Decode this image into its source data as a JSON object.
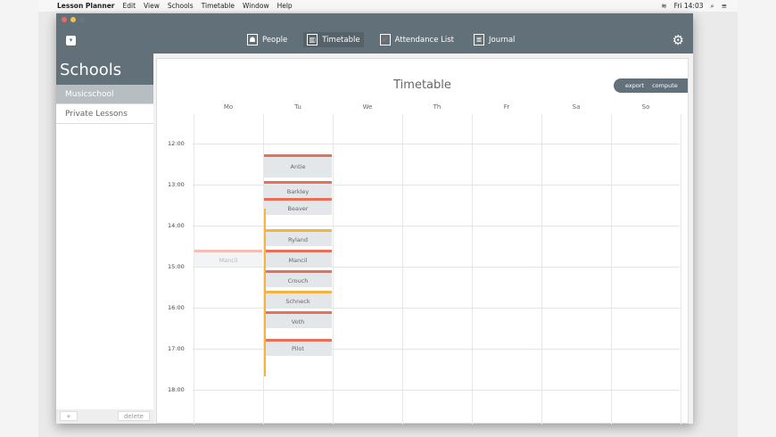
{
  "menubar": {
    "app": "Lesson Planner",
    "items": [
      "Edit",
      "View",
      "Schools",
      "Timetable",
      "Window",
      "Help"
    ],
    "clock": "Fri 14:03"
  },
  "toolbar": {
    "nav": [
      {
        "label": "People",
        "icon": "people-icon"
      },
      {
        "label": "Timetable",
        "icon": "timetable-icon",
        "active": true
      },
      {
        "label": "Attendance List",
        "icon": "checklist-icon"
      },
      {
        "label": "Journal",
        "icon": "journal-icon"
      }
    ]
  },
  "sidebar": {
    "title": "Schools",
    "items": [
      {
        "label": "Musicschool",
        "selected": true
      },
      {
        "label": "Private Lessons"
      }
    ],
    "add": "+",
    "delete": "delete"
  },
  "timetable": {
    "title": "Timetable",
    "export": "export",
    "compute": "compute",
    "days": [
      "Mo",
      "Tu",
      "We",
      "Th",
      "Fr",
      "Sa",
      "So"
    ],
    "hours": [
      "12:00",
      "13:00",
      "14:00",
      "15:00",
      "16:00",
      "17:00",
      "18:00"
    ],
    "colors": {
      "red": "#e8705a",
      "orange": "#f5b342"
    },
    "events": [
      {
        "name": "Antie",
        "day": 1,
        "start": "12:15",
        "end": "12:50",
        "color": "red"
      },
      {
        "name": "Barkley",
        "day": 1,
        "start": "12:55",
        "end": "13:20",
        "color": "red"
      },
      {
        "name": "Beaver",
        "day": 1,
        "start": "13:20",
        "end": "13:45",
        "color": "red"
      },
      {
        "name": "Ryland",
        "day": 1,
        "start": "14:05",
        "end": "14:30",
        "color": "orange"
      },
      {
        "name": "Mancil",
        "day": 1,
        "start": "14:35",
        "end": "15:00",
        "color": "red"
      },
      {
        "name": "Crouch",
        "day": 1,
        "start": "15:05",
        "end": "15:30",
        "color": "red"
      },
      {
        "name": "Schneck",
        "day": 1,
        "start": "15:35",
        "end": "16:00",
        "color": "orange"
      },
      {
        "name": "Voth",
        "day": 1,
        "start": "16:05",
        "end": "16:30",
        "color": "red"
      },
      {
        "name": "Pilot",
        "day": 1,
        "start": "16:45",
        "end": "17:10",
        "color": "red"
      },
      {
        "name": "Mancil",
        "day": 0,
        "start": "14:35",
        "end": "15:00",
        "color": "red",
        "ghost": true
      }
    ],
    "availability": {
      "day": 1,
      "start": "13:35",
      "end": "17:40"
    }
  }
}
